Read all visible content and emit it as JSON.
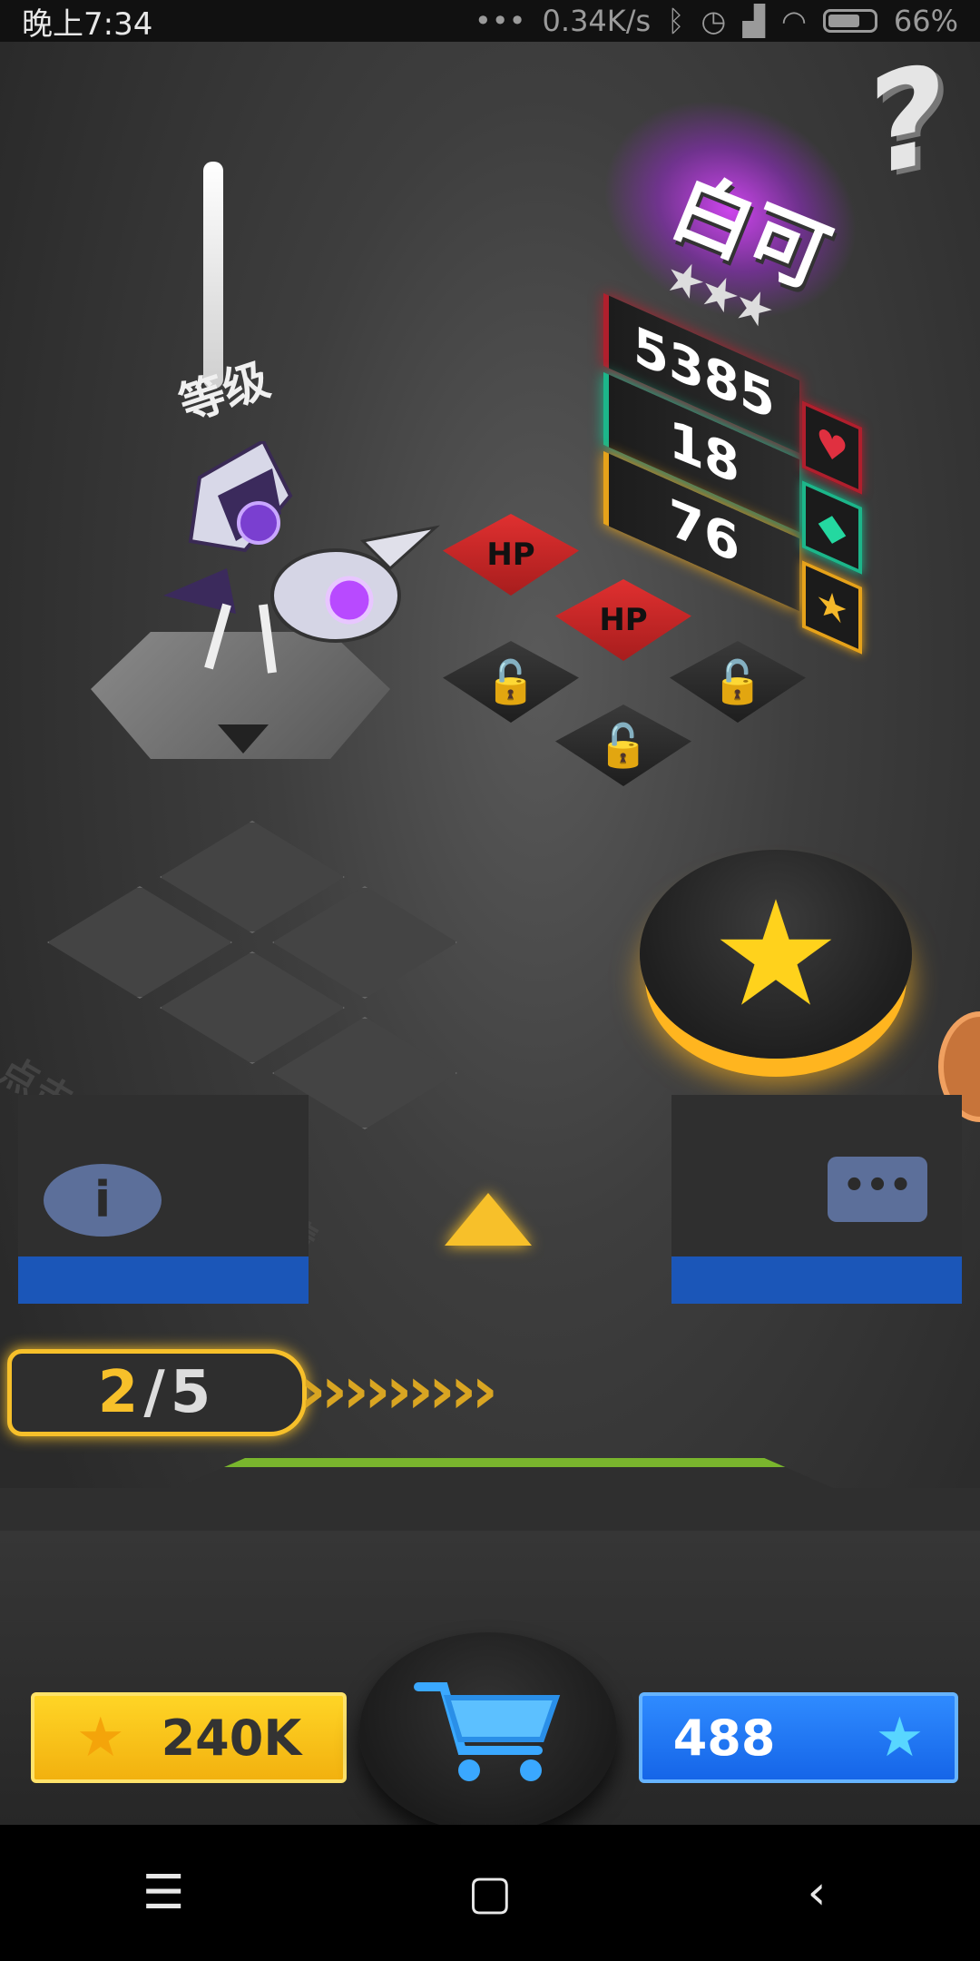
{
  "status_bar": {
    "time": "晚上7:34",
    "network_speed": "0.34K/s",
    "battery": "66%",
    "icons": [
      "dots-icon",
      "bluetooth-icon",
      "alarm-icon",
      "signal-icon",
      "wifi-icon",
      "battery-icon"
    ]
  },
  "hero": {
    "name": "白可",
    "stars": "★★★",
    "level": "I",
    "level_label": "等级"
  },
  "stats": {
    "hp": "5385",
    "defense": "18",
    "attack": "76",
    "colors": {
      "hp": "#b01f2d",
      "defense": "#1cb68a",
      "attack": "#e6a21a"
    }
  },
  "chips": {
    "hp_label": "HP",
    "lock_icon": "lock-icon"
  },
  "hint": "点击芯片可查看详情",
  "progress": {
    "current": "2",
    "separator": "/",
    "total": "5"
  },
  "chevrons": "›››››››››",
  "currency": {
    "coins": "240K",
    "gems": "488"
  },
  "icons": {
    "help": "?",
    "info": "i",
    "chat": "•••",
    "star": "★",
    "heart": "♥",
    "shield": "◆",
    "lock": "🔓",
    "arrow_up": "▲"
  },
  "nav": {
    "menu": "☰",
    "home": "▢",
    "back": "‹"
  }
}
